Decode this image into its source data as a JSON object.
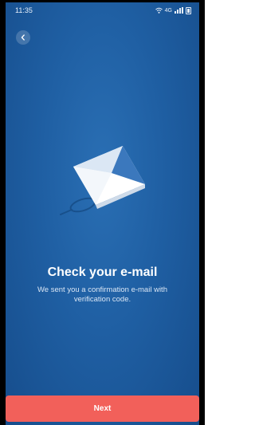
{
  "status_bar": {
    "time": "11:35",
    "network_label": "4G"
  },
  "header": {
    "back_icon": "chevron-left-icon"
  },
  "illustration": {
    "icon": "envelope-icon",
    "secondary_icon": "magnifier-shadow"
  },
  "main": {
    "title": "Check your e-mail",
    "message": "We sent you a confirmation e-mail with verification code."
  },
  "footer": {
    "next_label": "Next"
  },
  "colors": {
    "background": "#1f5fa3",
    "accent_button": "#f2605a",
    "text": "#ffffff"
  }
}
